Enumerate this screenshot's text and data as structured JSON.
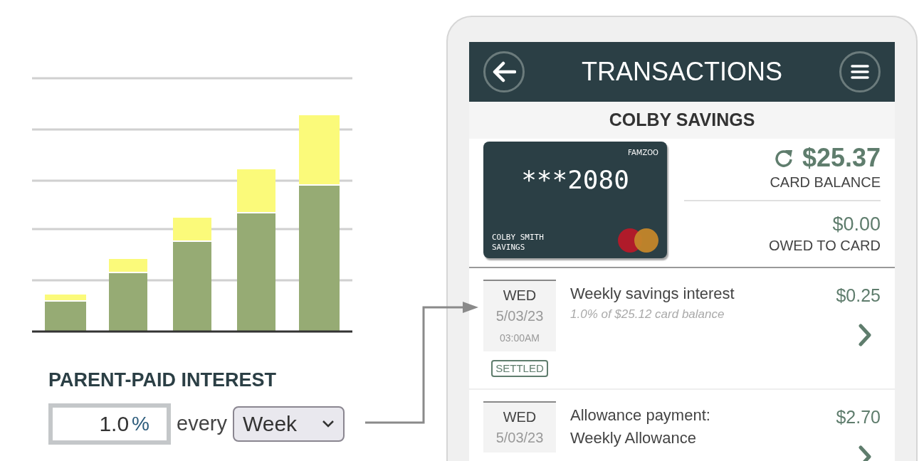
{
  "settings": {
    "heading": "PARENT-PAID INTEREST",
    "rate": "1.0",
    "rate_unit": "%",
    "connector": "every",
    "period": "Week"
  },
  "phone": {
    "title": "TRANSACTIONS",
    "account": "COLBY SAVINGS",
    "card": {
      "brand": "FAMZOO",
      "number": "***2080",
      "holder": "COLBY SMITH",
      "account_type": "SAVINGS"
    },
    "balance": {
      "amount": "$25.37",
      "label": "CARD BALANCE"
    },
    "owed": {
      "amount": "$0.00",
      "label": "OWED TO CARD"
    },
    "transactions": [
      {
        "day": "WED",
        "date": "5/03/23",
        "time": "03:00AM",
        "status": "SETTLED",
        "title": "Weekly savings interest",
        "subtitle": "1.0% of $25.12 card balance",
        "amount": "$0.25"
      },
      {
        "day": "WED",
        "date": "5/03/23",
        "title": "Allowance payment: Weekly Allowance",
        "amount": "$2.70"
      }
    ]
  }
}
